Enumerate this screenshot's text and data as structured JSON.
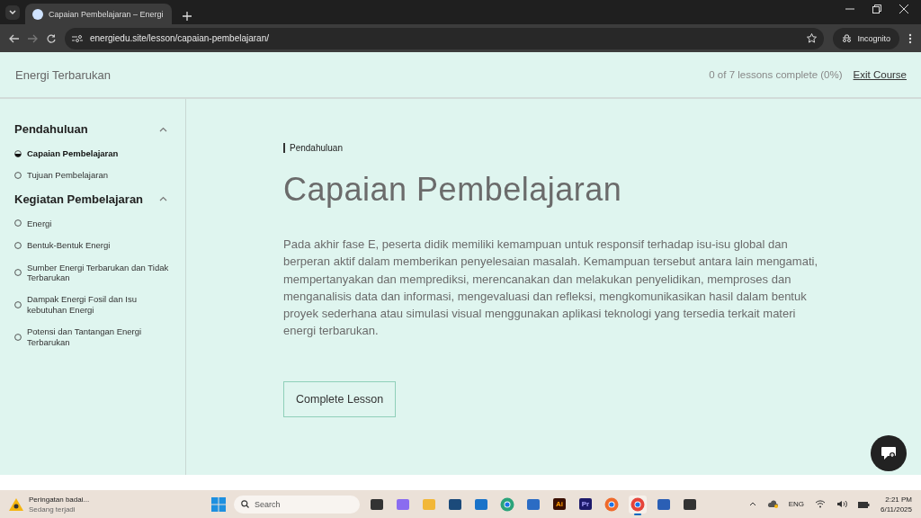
{
  "browser": {
    "tab_title": "Capaian Pembelajaran – Energi",
    "url": "energiedu.site/lesson/capaian-pembelajaran/",
    "profile": "Incognito"
  },
  "header": {
    "course_title": "Energi Terbarukan",
    "progress": "0 of 7 lessons complete (0%)",
    "exit_link": "Exit Course"
  },
  "sidebar": {
    "sections": [
      {
        "title": "Pendahuluan",
        "expanded": true,
        "lessons": [
          {
            "title": "Capaian Pembelajaran",
            "selected": true
          },
          {
            "title": "Tujuan Pembelajaran",
            "selected": false
          }
        ]
      },
      {
        "title": "Kegiatan Pembelajaran",
        "expanded": true,
        "lessons": [
          {
            "title": "Energi",
            "selected": false
          },
          {
            "title": "Bentuk-Bentuk Energi",
            "selected": false
          },
          {
            "title": "Sumber Energi Terbarukan dan Tidak Terbarukan",
            "selected": false
          },
          {
            "title": "Dampak Energi Fosil dan Isu kebutuhan Energi",
            "selected": false
          },
          {
            "title": "Potensi dan Tantangan Energi Terbarukan",
            "selected": false
          }
        ]
      }
    ]
  },
  "lesson": {
    "breadcrumb": "Pendahuluan",
    "title": "Capaian Pembelajaran",
    "body": "Pada akhir fase E, peserta didik memiliki kemampuan untuk responsif terhadap isu-isu global dan berperan aktif dalam memberikan penyelesaian masalah. Kemampuan tersebut antara lain mengamati, mempertanyakan dan memprediksi, merencanakan dan melakukan penyelidikan, memproses dan menganalisis data dan informasi, mengevaluasi dan refleksi, mengkomunikasikan hasil dalam bentuk proyek sederhana atau simulasi visual menggunakan aplikasi teknologi yang tersedia terkait materi energi terbarukan.",
    "button": "Complete Lesson"
  },
  "taskbar": {
    "weather_title": "Peringatan badai...",
    "weather_subtitle": "Sedang terjadi",
    "search_placeholder": "Search",
    "apps": [
      {
        "kind": "task-view",
        "active": false
      },
      {
        "kind": "copilot",
        "active": false
      },
      {
        "kind": "folder",
        "active": false
      },
      {
        "kind": "store-dark",
        "active": false
      },
      {
        "kind": "outlook",
        "active": false
      },
      {
        "kind": "edge",
        "active": false
      },
      {
        "kind": "store",
        "active": false
      },
      {
        "kind": "illustrator",
        "label": "Ai",
        "active": false
      },
      {
        "kind": "premiere",
        "label": "Pr",
        "active": false
      },
      {
        "kind": "firefox",
        "active": false
      },
      {
        "kind": "chrome",
        "active": true
      },
      {
        "kind": "word",
        "active": false
      },
      {
        "kind": "terminal",
        "active": false
      }
    ],
    "language": "ENG",
    "time": "2:21 PM",
    "date": "6/11/2025"
  }
}
